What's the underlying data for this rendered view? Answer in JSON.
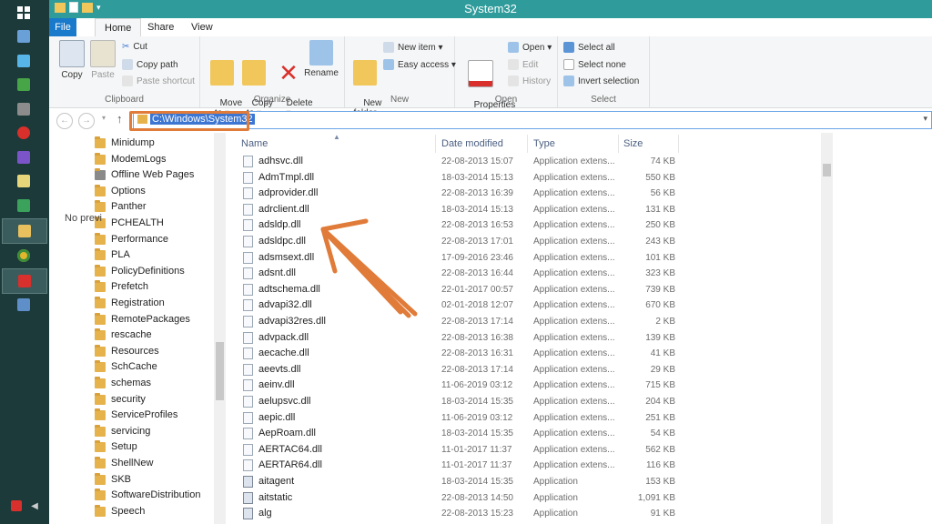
{
  "window": {
    "title": "System32"
  },
  "ribbon_tabs": [
    "File",
    "Home",
    "Share",
    "View"
  ],
  "ribbon": {
    "clipboard": {
      "label": "Clipboard",
      "copy": "Copy",
      "paste": "Paste",
      "cut": "Cut",
      "copy_path": "Copy path",
      "paste_shortcut": "Paste shortcut"
    },
    "organize": {
      "label": "Organize",
      "move_to": "Move\nto ▾",
      "copy_to": "Copy\nto ▾",
      "delete": "Delete\n▾",
      "rename": "Rename"
    },
    "new": {
      "label": "New",
      "new_folder": "New\nfolder",
      "new_item": "New item ▾",
      "easy_access": "Easy access ▾"
    },
    "open": {
      "label": "Open",
      "properties": "Properties\n▾",
      "open": "Open ▾",
      "edit": "Edit",
      "history": "History"
    },
    "select": {
      "label": "Select",
      "select_all": "Select all",
      "select_none": "Select none",
      "invert_selection": "Invert selection"
    }
  },
  "address": {
    "path": "C:\\Windows\\System32"
  },
  "nav_folders": [
    "Minidump",
    "ModemLogs",
    "Offline Web Pages",
    "Options",
    "Panther",
    "PCHEALTH",
    "Performance",
    "PLA",
    "PolicyDefinitions",
    "Prefetch",
    "Registration",
    "RemotePackages",
    "rescache",
    "Resources",
    "SchCache",
    "schemas",
    "security",
    "ServiceProfiles",
    "servicing",
    "Setup",
    "ShellNew",
    "SKB",
    "SoftwareDistribution",
    "Speech"
  ],
  "columns": {
    "name": "Name",
    "date": "Date modified",
    "type": "Type",
    "size": "Size"
  },
  "files": [
    {
      "name": "adhsvc.dll",
      "date": "22-08-2013 15:07",
      "type": "Application extens...",
      "size": "74 KB"
    },
    {
      "name": "AdmTmpl.dll",
      "date": "18-03-2014 15:13",
      "type": "Application extens...",
      "size": "550 KB"
    },
    {
      "name": "adprovider.dll",
      "date": "22-08-2013 16:39",
      "type": "Application extens...",
      "size": "56 KB"
    },
    {
      "name": "adrclient.dll",
      "date": "18-03-2014 15:13",
      "type": "Application extens...",
      "size": "131 KB"
    },
    {
      "name": "adsldp.dll",
      "date": "22-08-2013 16:53",
      "type": "Application extens...",
      "size": "250 KB"
    },
    {
      "name": "adsldpc.dll",
      "date": "22-08-2013 17:01",
      "type": "Application extens...",
      "size": "243 KB"
    },
    {
      "name": "adsmsext.dll",
      "date": "17-09-2016 23:46",
      "type": "Application extens...",
      "size": "101 KB"
    },
    {
      "name": "adsnt.dll",
      "date": "22-08-2013 16:44",
      "type": "Application extens...",
      "size": "323 KB"
    },
    {
      "name": "adtschema.dll",
      "date": "22-01-2017 00:57",
      "type": "Application extens...",
      "size": "739 KB"
    },
    {
      "name": "advapi32.dll",
      "date": "02-01-2018 12:07",
      "type": "Application extens...",
      "size": "670 KB"
    },
    {
      "name": "advapi32res.dll",
      "date": "22-08-2013 17:14",
      "type": "Application extens...",
      "size": "2 KB"
    },
    {
      "name": "advpack.dll",
      "date": "22-08-2013 16:38",
      "type": "Application extens...",
      "size": "139 KB"
    },
    {
      "name": "aecache.dll",
      "date": "22-08-2013 16:31",
      "type": "Application extens...",
      "size": "41 KB"
    },
    {
      "name": "aeevts.dll",
      "date": "22-08-2013 17:14",
      "type": "Application extens...",
      "size": "29 KB"
    },
    {
      "name": "aeinv.dll",
      "date": "11-06-2019 03:12",
      "type": "Application extens...",
      "size": "715 KB"
    },
    {
      "name": "aelupsvc.dll",
      "date": "18-03-2014 15:35",
      "type": "Application extens...",
      "size": "204 KB"
    },
    {
      "name": "aepic.dll",
      "date": "11-06-2019 03:12",
      "type": "Application extens...",
      "size": "251 KB"
    },
    {
      "name": "AepRoam.dll",
      "date": "18-03-2014 15:35",
      "type": "Application extens...",
      "size": "54 KB"
    },
    {
      "name": "AERTAC64.dll",
      "date": "11-01-2017 11:37",
      "type": "Application extens...",
      "size": "562 KB"
    },
    {
      "name": "AERTAR64.dll",
      "date": "11-01-2017 11:37",
      "type": "Application extens...",
      "size": "116 KB"
    },
    {
      "name": "aitagent",
      "date": "18-03-2014 15:35",
      "type": "Application",
      "size": "153 KB"
    },
    {
      "name": "aitstatic",
      "date": "22-08-2013 14:50",
      "type": "Application",
      "size": "1,091 KB"
    },
    {
      "name": "alg",
      "date": "22-08-2013 15:23",
      "type": "Application",
      "size": "91 KB"
    }
  ],
  "preview": {
    "text": "No previ"
  },
  "colors": {
    "title_bar": "#2f9b9b",
    "taskbar": "#1c3a3a",
    "file_tab": "#1979ca",
    "annotation": "#e07b39",
    "selection": "#3c76d2"
  }
}
